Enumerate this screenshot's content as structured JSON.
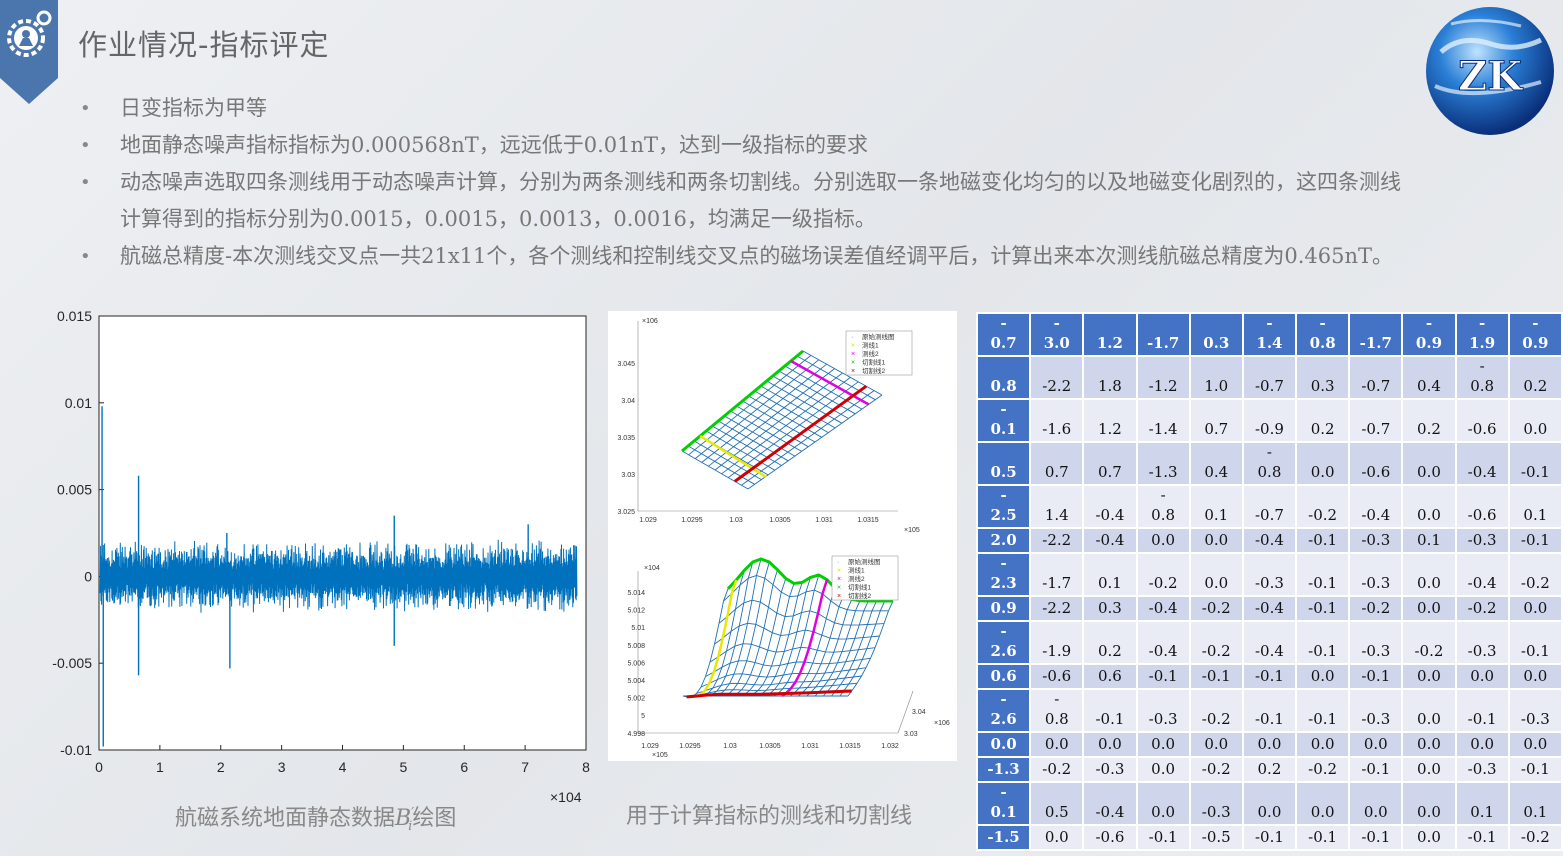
{
  "header": {
    "title": "作业情况-指标评定",
    "badge_icon": "engineer-gear-icon",
    "logo_icon": "zk-globe-logo",
    "logo_text": "ZK"
  },
  "bullets": [
    {
      "text": "日变指标为甲等"
    },
    {
      "text": "地面静态噪声指标指标为0.000568nT，远远低于0.01nT，达到一级指标的要求"
    },
    {
      "text": "动态噪声选取四条测线用于动态噪声计算，分别为两条测线和两条切割线。分别选取一条地磁变化均匀的以及地磁变化剧烈的，这四条测线",
      "text2": "计算得到的指标分别为0.0015，0.0015，0.0013，0.0016，均满足一级指标。"
    },
    {
      "text": "航磁总精度-本次测线交叉点一共21x11个，各个测线和控制线交叉点的磁场误差值经调平后，计算出来本次测线航磁总精度为0.465nT。"
    }
  ],
  "captions": {
    "left_prefix": "航磁系统地面静态数据",
    "left_symbol": "B",
    "left_sup": "′",
    "left_sub": "i",
    "left_suffix": "绘图",
    "middle": "用于计算指标的测线和切割线"
  },
  "chart_data": [
    {
      "type": "line",
      "title": "",
      "xlabel": "",
      "ylabel": "",
      "xlim": [
        0,
        8
      ],
      "x_multiplier": "×10^4",
      "ylim": [
        -0.01,
        0.015
      ],
      "x_ticks": [
        "0",
        "1",
        "2",
        "3",
        "4",
        "5",
        "6",
        "7",
        "8"
      ],
      "y_ticks": [
        "0.015",
        "0.01",
        "0.005",
        "0",
        "-0.005",
        "-0.01"
      ],
      "color": "#0072bd",
      "series_description": "dense noise band about ±0.001 with spikes",
      "x_end": 7.85,
      "spikes": [
        [
          0.05,
          0.0098
        ],
        [
          0.07,
          -0.0098
        ],
        [
          0.65,
          0.0058
        ],
        [
          0.65,
          -0.0057
        ],
        [
          2.1,
          0.0025
        ],
        [
          2.15,
          -0.0053
        ],
        [
          3.95,
          0.0015
        ],
        [
          4.85,
          0.0035
        ],
        [
          4.85,
          -0.004
        ],
        [
          7.05,
          0.003
        ],
        [
          7.8,
          0.0018
        ]
      ],
      "grid": false
    },
    {
      "type": "surface-3d",
      "x_ticks": [
        "1.029",
        "1.0295",
        "1.03",
        "1.0305",
        "1.031",
        "1.0315"
      ],
      "x_multiplier": "×10^5",
      "y_ticks": [
        "3.025",
        "3.03",
        "3.035",
        "3.04",
        "3.045"
      ],
      "y_multiplier": "×10^6",
      "legend": [
        "原始测线图",
        "测线1",
        "测线2",
        "切割线1",
        "切割线2"
      ],
      "legend_colors": [
        "#1f6fb5",
        "#e0e000",
        "#e000e0",
        "#00c000",
        "#d00000"
      ]
    },
    {
      "type": "surface-3d",
      "x_ticks": [
        "1.029",
        "1.0295",
        "1.03",
        "1.0305",
        "1.031",
        "1.0315",
        "1.032"
      ],
      "x_multiplier": "×10^5",
      "z_ticks": [
        "5.014",
        "5.012",
        "5.01",
        "5.008",
        "5.006",
        "5.004",
        "5.002",
        "5",
        "4.998"
      ],
      "z_multiplier": "×10^4",
      "y_ticks": [
        "3.04",
        "3.03"
      ],
      "y_multiplier": "×10^6",
      "legend": [
        "原始测线图",
        "测线1",
        "测线2",
        "切割线1",
        "切割线2"
      ],
      "legend_colors": [
        "#1f6fb5",
        "#e0e000",
        "#e000e0",
        "#00c000",
        "#d00000"
      ]
    }
  ],
  "table": {
    "header": [
      "0.7",
      "3.0",
      "1.2",
      "-1.7",
      "0.3",
      "1.4",
      "0.8",
      "-1.7",
      "0.9",
      "1.9",
      "0.9"
    ],
    "header_minus": [
      true,
      true,
      false,
      false,
      false,
      true,
      true,
      false,
      true,
      true,
      true
    ],
    "rows": [
      {
        "h": "0.8",
        "hm": false,
        "c": [
          "-2.2",
          "1.8",
          "-1.2",
          "1.0",
          "-0.7",
          "0.3",
          "-0.7",
          "0.4",
          "0.8",
          "0.2"
        ],
        "cm": [
          0,
          0,
          0,
          0,
          0,
          0,
          0,
          0,
          1,
          0
        ]
      },
      {
        "h": "0.1",
        "hm": true,
        "c": [
          "-1.6",
          "1.2",
          "-1.4",
          "0.7",
          "-0.9",
          "0.2",
          "-0.7",
          "0.2",
          "-0.6",
          "0.0"
        ],
        "cm": [
          0,
          0,
          0,
          0,
          0,
          0,
          0,
          0,
          0,
          0
        ]
      },
      {
        "h": "0.5",
        "hm": false,
        "c": [
          "0.7",
          "0.7",
          "-1.3",
          "0.4",
          "0.8",
          "0.0",
          "-0.6",
          "0.0",
          "-0.4",
          "-0.1"
        ],
        "cm": [
          0,
          0,
          0,
          0,
          1,
          0,
          0,
          0,
          0,
          0
        ]
      },
      {
        "h": "2.5",
        "hm": true,
        "c": [
          "1.4",
          "-0.4",
          "0.8",
          "0.1",
          "-0.7",
          "-0.2",
          "-0.4",
          "0.0",
          "-0.6",
          "0.1"
        ],
        "cm": [
          0,
          0,
          1,
          0,
          0,
          0,
          0,
          0,
          0,
          0
        ]
      },
      {
        "h": "2.0",
        "hm": false,
        "c": [
          "-2.2",
          "-0.4",
          "0.0",
          "0.0",
          "-0.4",
          "-0.1",
          "-0.3",
          "0.1",
          "-0.3",
          "-0.1"
        ],
        "cm": [
          0,
          0,
          0,
          0,
          0,
          0,
          0,
          0,
          0,
          0
        ]
      },
      {
        "h": "2.3",
        "hm": true,
        "c": [
          "-1.7",
          "0.1",
          "-0.2",
          "0.0",
          "-0.3",
          "-0.1",
          "-0.3",
          "0.0",
          "-0.4",
          "-0.2"
        ],
        "cm": [
          0,
          0,
          0,
          0,
          0,
          0,
          0,
          0,
          0,
          0
        ]
      },
      {
        "h": "0.9",
        "hm": false,
        "c": [
          "-2.2",
          "0.3",
          "-0.4",
          "-0.2",
          "-0.4",
          "-0.1",
          "-0.2",
          "0.0",
          "-0.2",
          "0.0"
        ],
        "cm": [
          0,
          0,
          0,
          0,
          0,
          0,
          0,
          0,
          0,
          0
        ]
      },
      {
        "h": "2.6",
        "hm": true,
        "c": [
          "-1.9",
          "0.2",
          "-0.4",
          "-0.2",
          "-0.4",
          "-0.1",
          "-0.3",
          "-0.2",
          "-0.3",
          "-0.1"
        ],
        "cm": [
          0,
          0,
          0,
          0,
          0,
          0,
          0,
          0,
          0,
          0
        ]
      },
      {
        "h": "0.6",
        "hm": false,
        "c": [
          "-0.6",
          "0.6",
          "-0.1",
          "-0.1",
          "-0.1",
          "0.0",
          "-0.1",
          "0.0",
          "0.0",
          "0.0"
        ],
        "cm": [
          0,
          0,
          0,
          0,
          0,
          0,
          0,
          0,
          0,
          0
        ]
      },
      {
        "h": "2.6",
        "hm": true,
        "c": [
          "0.8",
          "-0.1",
          "-0.3",
          "-0.2",
          "-0.1",
          "-0.1",
          "-0.3",
          "0.0",
          "-0.1",
          "-0.3"
        ],
        "cm": [
          1,
          0,
          0,
          0,
          0,
          0,
          0,
          0,
          0,
          0
        ]
      },
      {
        "h": "0.0",
        "hm": false,
        "c": [
          "0.0",
          "0.0",
          "0.0",
          "0.0",
          "0.0",
          "0.0",
          "0.0",
          "0.0",
          "0.0",
          "0.0"
        ],
        "cm": [
          0,
          0,
          0,
          0,
          0,
          0,
          0,
          0,
          0,
          0
        ]
      },
      {
        "h": "-1.3",
        "hm": false,
        "c": [
          "-0.2",
          "-0.3",
          "0.0",
          "-0.2",
          "0.2",
          "-0.2",
          "-0.1",
          "0.0",
          "-0.3",
          "-0.1"
        ],
        "cm": [
          0,
          0,
          0,
          0,
          0,
          0,
          0,
          0,
          0,
          0
        ]
      },
      {
        "h": "0.1",
        "hm": true,
        "c": [
          "0.5",
          "-0.4",
          "0.0",
          "-0.3",
          "0.0",
          "0.0",
          "0.0",
          "0.0",
          "0.1",
          "0.1"
        ],
        "cm": [
          0,
          0,
          0,
          0,
          0,
          0,
          0,
          0,
          0,
          0
        ]
      },
      {
        "h": "-1.5",
        "hm": false,
        "c": [
          "0.0",
          "-0.6",
          "-0.1",
          "-0.5",
          "-0.1",
          "-0.1",
          "-0.1",
          "0.0",
          "-0.1",
          "-0.2"
        ],
        "cm": [
          0,
          0,
          0,
          0,
          0,
          0,
          0,
          0,
          0,
          0
        ]
      }
    ],
    "minus_glyph": "-"
  }
}
